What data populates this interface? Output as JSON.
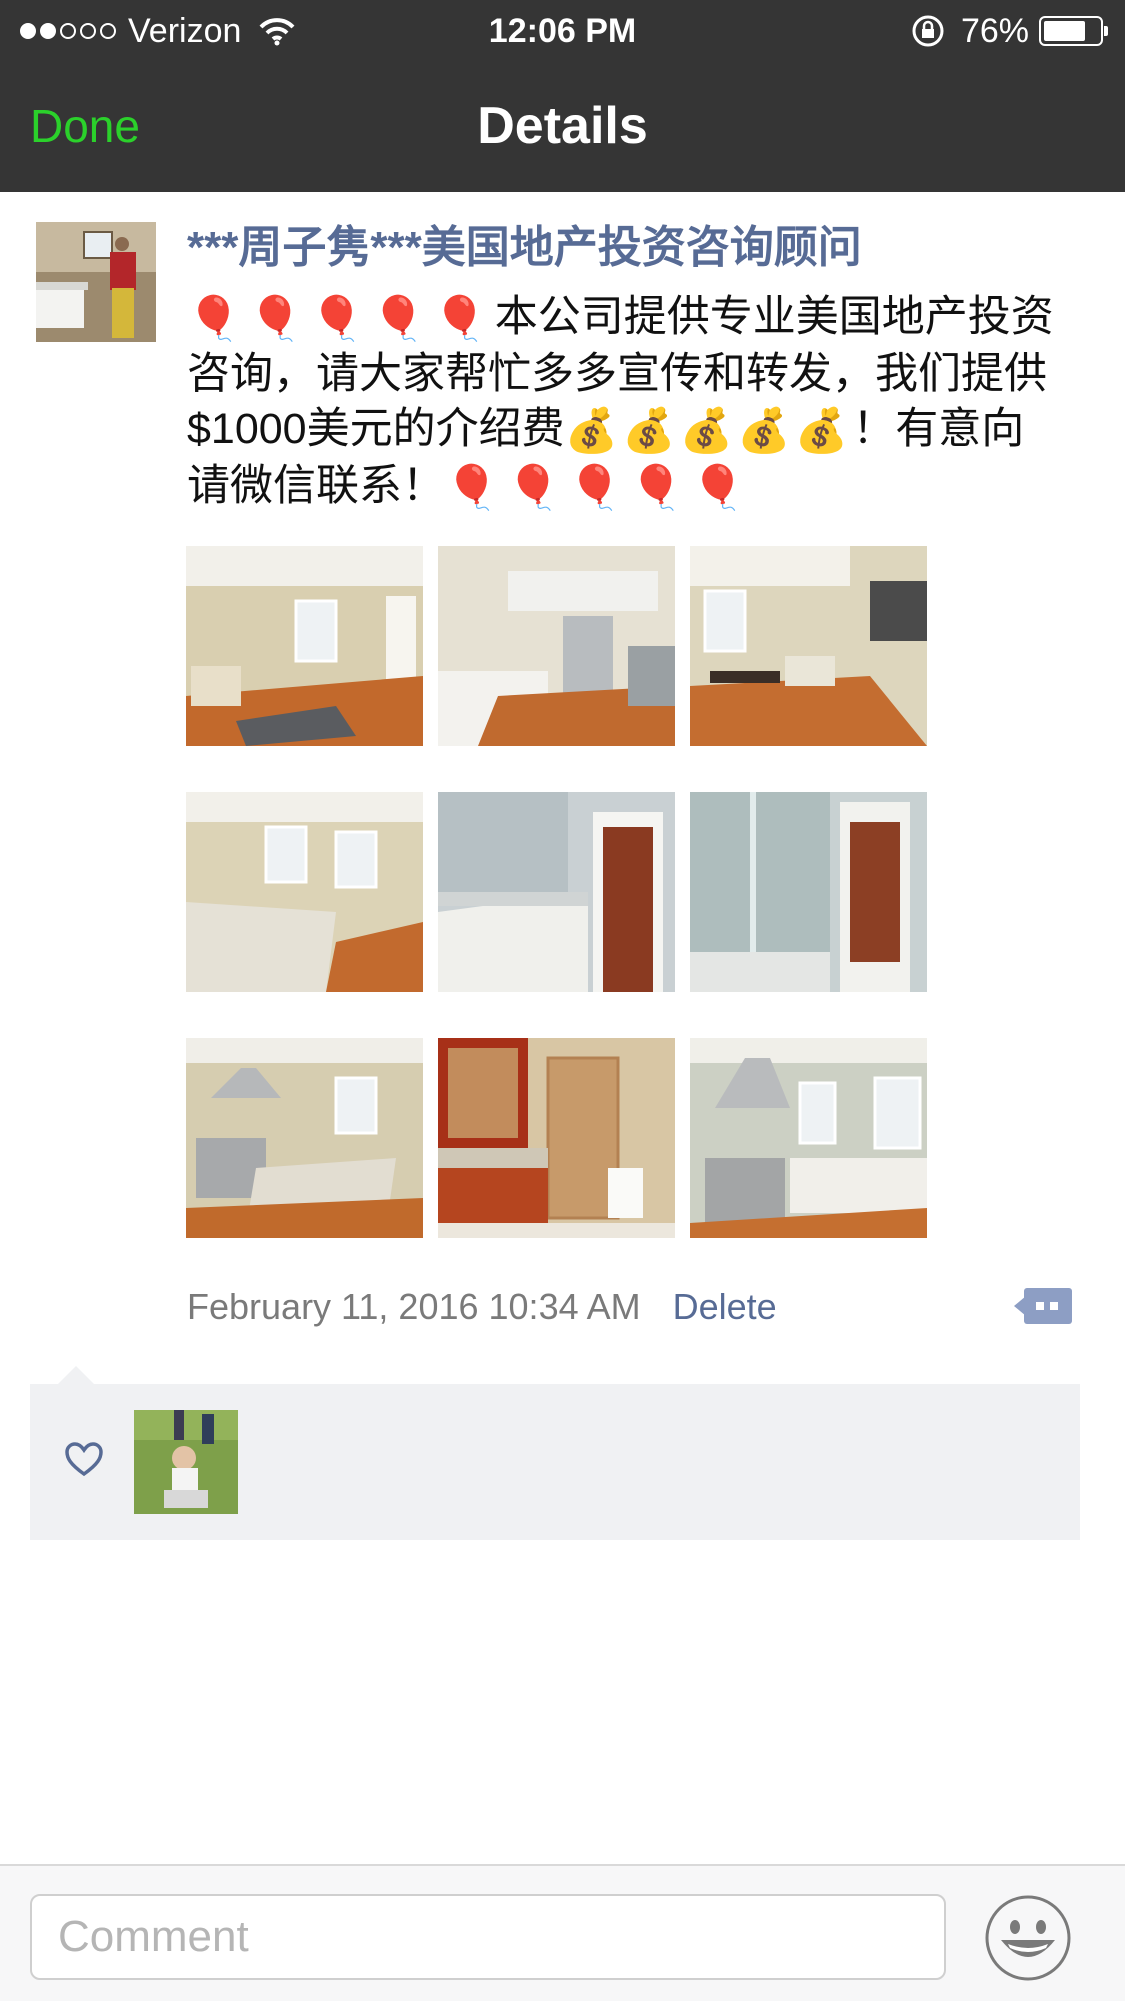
{
  "status_bar": {
    "carrier": "Verizon",
    "time": "12:06 PM",
    "battery": "76%",
    "battery_level": 0.76
  },
  "nav": {
    "back_label": "Done",
    "title": "Details"
  },
  "post": {
    "author": "***周子隽***美国地产投资咨询顾问",
    "text_line1": "本公司提供专业美国地产投资",
    "text_line2": "咨询，请大家帮忙多多宣传和转发，我们提供",
    "text_line3_a": "$1000美元的介绍费",
    "text_line3_b": "！有意向",
    "text_line4": "请微信联系！",
    "balloon_emoji": "🎈",
    "money_bag_emoji": "💰",
    "photos": [
      {
        "name": "living-room-photo"
      },
      {
        "name": "kitchen-fridge-photo"
      },
      {
        "name": "dining-area-photo"
      },
      {
        "name": "kitchen-island-photo"
      },
      {
        "name": "bathroom-vanity-photo"
      },
      {
        "name": "shower-photo"
      },
      {
        "name": "kitchen-range-photo"
      },
      {
        "name": "master-bath-photo"
      },
      {
        "name": "kitchen-hood-photo"
      }
    ],
    "timestamp": "February 11, 2016 10:34 AM",
    "delete_label": "Delete"
  },
  "comment_bar": {
    "placeholder": "Comment"
  },
  "colors": {
    "header_bg": "#353535",
    "accent_green": "#2bd12b",
    "link_blue": "#576b95",
    "like_bg": "#f0f1f3"
  }
}
